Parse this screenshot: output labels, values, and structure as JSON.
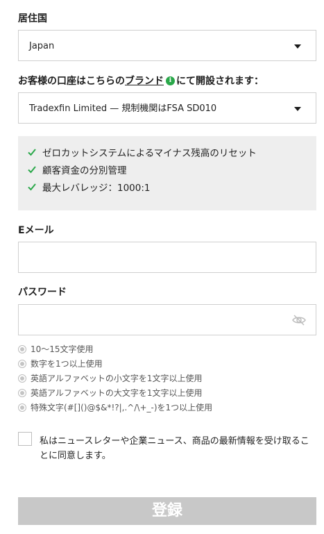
{
  "residence": {
    "label": "居住国",
    "value": "Japan"
  },
  "brand": {
    "label_prefix": "お客様の口座はこちらの",
    "link_text": "ブランド",
    "info_glyph": "i",
    "label_suffix": "にて開設されます：",
    "value": "Tradexfin Limited — 規制機関はFSA SD010"
  },
  "features": [
    "ゼロカットシステムによるマイナス残高のリセット",
    "顧客資金の分別管理",
    "最大レバレッジ：1000:1"
  ],
  "email": {
    "label": "Eメール",
    "value": ""
  },
  "password": {
    "label": "パスワード",
    "value": ""
  },
  "password_rules": [
    "10〜15文字使用",
    "数字を1つ以上使用",
    "英語アルファベットの小文字を1文字以上使用",
    "英語アルファベットの大文字を1文字以上使用",
    "特殊文字(#[]()@$&*!?|,.^/\\+_-)を1つ以上使用"
  ],
  "newsletter": {
    "text": "私はニュースレターや企業ニュース、商品の最新情報を受け取ることに同意します。",
    "checked": false
  },
  "submit": {
    "label": "登録"
  },
  "colors": {
    "check_green": "#2aa84a",
    "feature_bg": "#eeeeee",
    "submit_disabled": "#c8c8c8"
  }
}
